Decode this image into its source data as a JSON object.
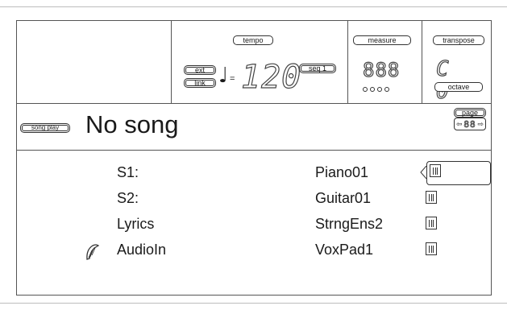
{
  "header": {
    "tempo_label": "tempo",
    "ext_label": "ext",
    "link_label": "link",
    "note_glyph": "♩",
    "equals": "=",
    "tempo_value": "120",
    "seq_label": "seq 1",
    "measure_label": "measure",
    "measure_value": "888",
    "transpose_label": "transpose",
    "transpose_value": "C 0",
    "octave_label": "octave"
  },
  "song": {
    "play_label": "song play",
    "name": "No song",
    "page_label": "page",
    "page_value": "88"
  },
  "tracks": [
    {
      "channel": "S1:",
      "instrument": "Piano01",
      "selected": true
    },
    {
      "channel": "S2:",
      "instrument": "Guitar01",
      "selected": false
    },
    {
      "channel": "Lyrics",
      "instrument": "StrngEns2",
      "selected": false
    },
    {
      "channel": "AudioIn",
      "instrument": "VoxPad1",
      "selected": false
    }
  ],
  "icons": {
    "audio_in": "harp-icon",
    "instrument": "keyboard-icon",
    "page_nav": "arrow-left-right-icon"
  }
}
